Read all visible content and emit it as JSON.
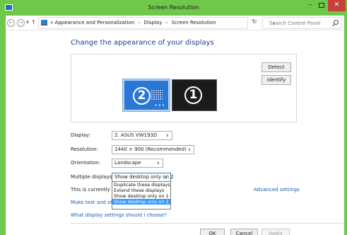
{
  "window": {
    "title": "Screen Resolution",
    "accent_color": "#6fc84a",
    "minimize_glyph": "–",
    "close_glyph": "✕"
  },
  "address": {
    "overflow": "«",
    "crumbs": [
      "Appearance and Personalization",
      "Display",
      "Screen Resolution"
    ],
    "separator": "›",
    "search_placeholder": "Search Control Panel"
  },
  "main": {
    "heading": "Change the appearance of your displays",
    "monitors": [
      {
        "number": "2",
        "selected": true
      },
      {
        "number": "1",
        "selected": false
      }
    ],
    "detect_label": "Detect",
    "identify_label": "Identify",
    "display_label": "Display:",
    "display_value": "2. ASUS VW193D",
    "resolution_label": "Resolution:",
    "resolution_value": "1440 × 900 (Recommended)",
    "orientation_label": "Orientation:",
    "orientation_value": "Landscape",
    "multiple_label": "Multiple displays:",
    "multiple_value": "Show desktop only on 2",
    "multiple_options": [
      "Duplicate these displays",
      "Extend these displays",
      "Show desktop only on 1",
      "Show desktop only on 2"
    ],
    "multiple_selected_index": 3,
    "currently_text": "This is currently your main display.",
    "advanced_link": "Advanced settings",
    "text_link": "Make text and other items larger or smaller",
    "settings_link": "What display settings should I choose?"
  },
  "footer": {
    "ok_label": "OK",
    "cancel_label": "Cancel",
    "apply_label": "Apply"
  }
}
